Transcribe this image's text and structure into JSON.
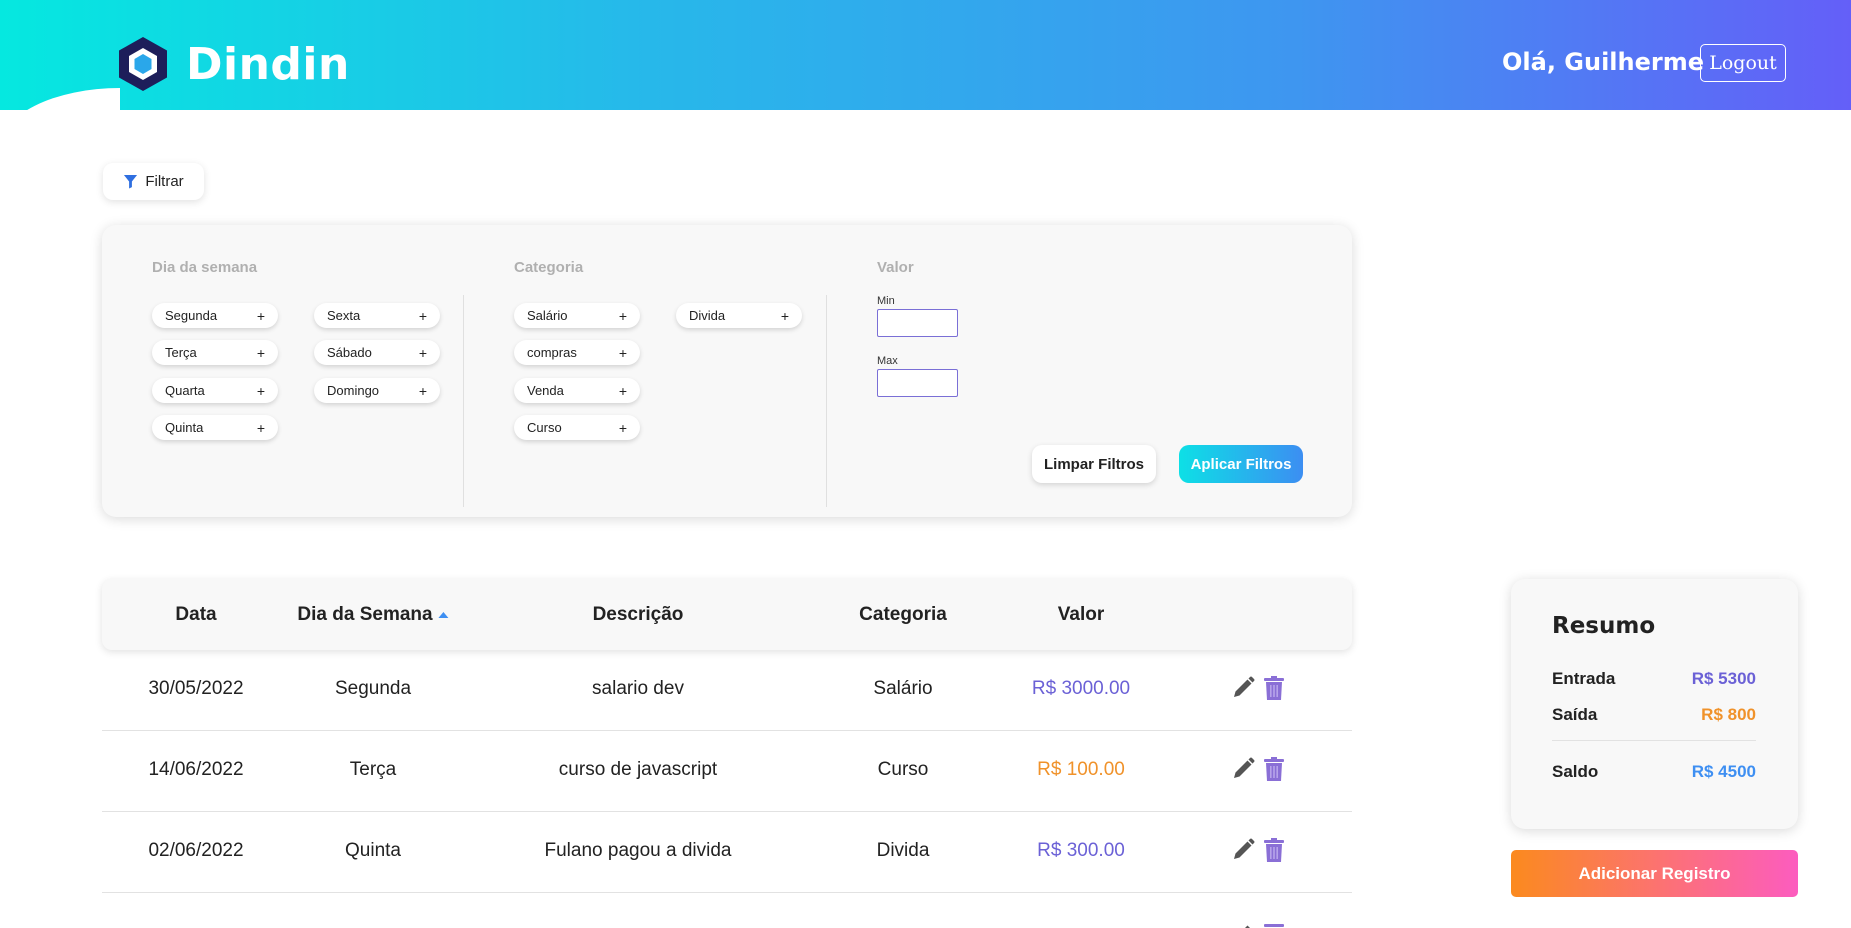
{
  "header": {
    "app_name": "Dindin",
    "greeting": "Olá, Guilherme",
    "logout_label": "Logout"
  },
  "filter_toggle": {
    "label": "Filtrar"
  },
  "filters": {
    "weekday": {
      "heading": "Dia da semana",
      "options": [
        "Segunda",
        "Terça",
        "Quarta",
        "Quinta",
        "Sexta",
        "Sábado",
        "Domingo"
      ]
    },
    "category": {
      "heading": "Categoria",
      "options": [
        "Salário",
        "compras",
        "Venda",
        "Curso",
        "Divida"
      ]
    },
    "value": {
      "heading": "Valor",
      "min_label": "Min",
      "max_label": "Max",
      "min_value": "",
      "max_value": ""
    },
    "chip_icon": "+",
    "clear_label": "Limpar Filtros",
    "apply_label": "Aplicar Filtros"
  },
  "table": {
    "columns": [
      "Data",
      "Dia da Semana",
      "Descrição",
      "Categoria",
      "Valor"
    ],
    "sorted_column": "Dia da Semana",
    "rows": [
      {
        "date": "30/05/2022",
        "weekday": "Segunda",
        "description": "salario dev",
        "category": "Salário",
        "value": "R$ 3000.00",
        "type": "entrada"
      },
      {
        "date": "14/06/2022",
        "weekday": "Terça",
        "description": "curso de javascript",
        "category": "Curso",
        "value": "R$ 100.00",
        "type": "saida"
      },
      {
        "date": "02/06/2022",
        "weekday": "Quinta",
        "description": "Fulano pagou a divida",
        "category": "Divida",
        "value": "R$ 300.00",
        "type": "entrada"
      }
    ]
  },
  "summary": {
    "title": "Resumo",
    "income_label": "Entrada",
    "income_value": "R$ 5300",
    "expense_label": "Saída",
    "expense_value": "R$ 800",
    "balance_label": "Saldo",
    "balance_value": "R$ 4500"
  },
  "add_button_label": "Adicionar Registro",
  "colors": {
    "income": "#6b61d6",
    "expense": "#f0922a",
    "balance": "#3e8ff2",
    "trash": "#8a6fd6"
  }
}
